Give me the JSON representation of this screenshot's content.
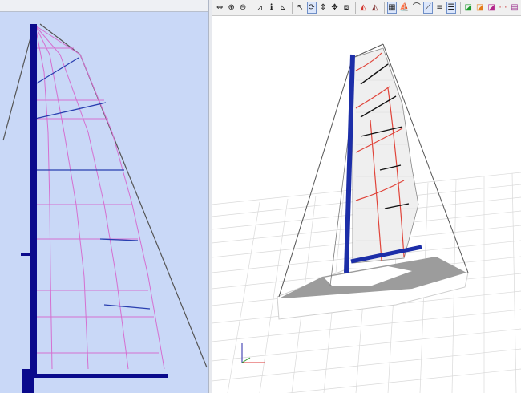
{
  "toolbar": {
    "buttons": [
      {
        "name": "pan-icon",
        "glyph": "⇔"
      },
      {
        "name": "zoom-in-icon",
        "glyph": "⊕"
      },
      {
        "name": "zoom-out-icon",
        "glyph": "⊖"
      },
      {
        "name": "sep"
      },
      {
        "name": "sail-profile-icon",
        "glyph": "⩘"
      },
      {
        "name": "info-icon",
        "glyph": "ℹ"
      },
      {
        "name": "chart-icon",
        "glyph": "⊾"
      },
      {
        "name": "sep"
      },
      {
        "name": "select-arrow-icon",
        "glyph": "↖"
      },
      {
        "name": "rotate-icon",
        "glyph": "⟳",
        "active": true
      },
      {
        "name": "move-vertical-icon",
        "glyph": "⇕"
      },
      {
        "name": "move-all-icon",
        "glyph": "✥"
      },
      {
        "name": "fit-view-icon",
        "glyph": "⧈"
      },
      {
        "name": "sep"
      },
      {
        "name": "sail-red-icon",
        "glyph": "◭",
        "color": "#d2342c"
      },
      {
        "name": "sail-outline-icon",
        "glyph": "◭",
        "color": "#7d2a2a"
      },
      {
        "name": "sep"
      },
      {
        "name": "grid-icon",
        "glyph": "▦",
        "active": true
      },
      {
        "name": "boat-icon",
        "glyph": "⛵"
      },
      {
        "name": "curve-icon",
        "glyph": "⌒"
      },
      {
        "name": "mast-bend-icon",
        "glyph": "⟋",
        "active": true
      },
      {
        "name": "stripes-icon",
        "glyph": "≡"
      },
      {
        "name": "list-icon",
        "glyph": "☰",
        "active": true
      },
      {
        "name": "sep"
      },
      {
        "name": "color-sail-green-icon",
        "glyph": "◪",
        "color": "#1c9a2c"
      },
      {
        "name": "color-sail-orange-icon",
        "glyph": "◪",
        "color": "#e37a18"
      },
      {
        "name": "color-sail-multi-icon",
        "glyph": "◪",
        "color": "#b3248b"
      },
      {
        "name": "stitch-lines-icon",
        "glyph": "⋯",
        "color": "#c42c2c"
      },
      {
        "name": "panel-lines-icon",
        "glyph": "▤",
        "color": "#9a2f8c"
      }
    ]
  }
}
